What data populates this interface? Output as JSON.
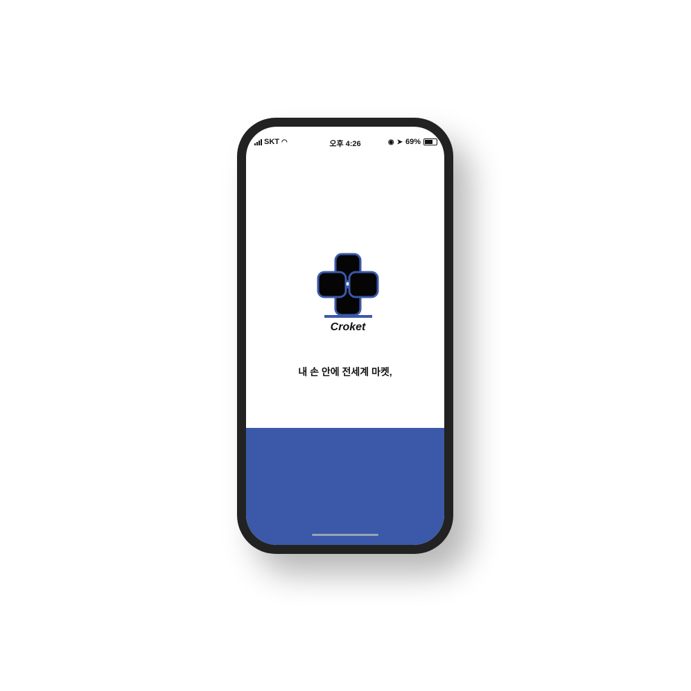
{
  "status_bar": {
    "carrier": "SKT",
    "time": "오후 4:26",
    "battery": "69%"
  },
  "app": {
    "name": "Croket",
    "tagline": "내 손 안에 전세계 마켓,"
  },
  "colors": {
    "brand": "#3b59a8",
    "frame": "#222222"
  }
}
